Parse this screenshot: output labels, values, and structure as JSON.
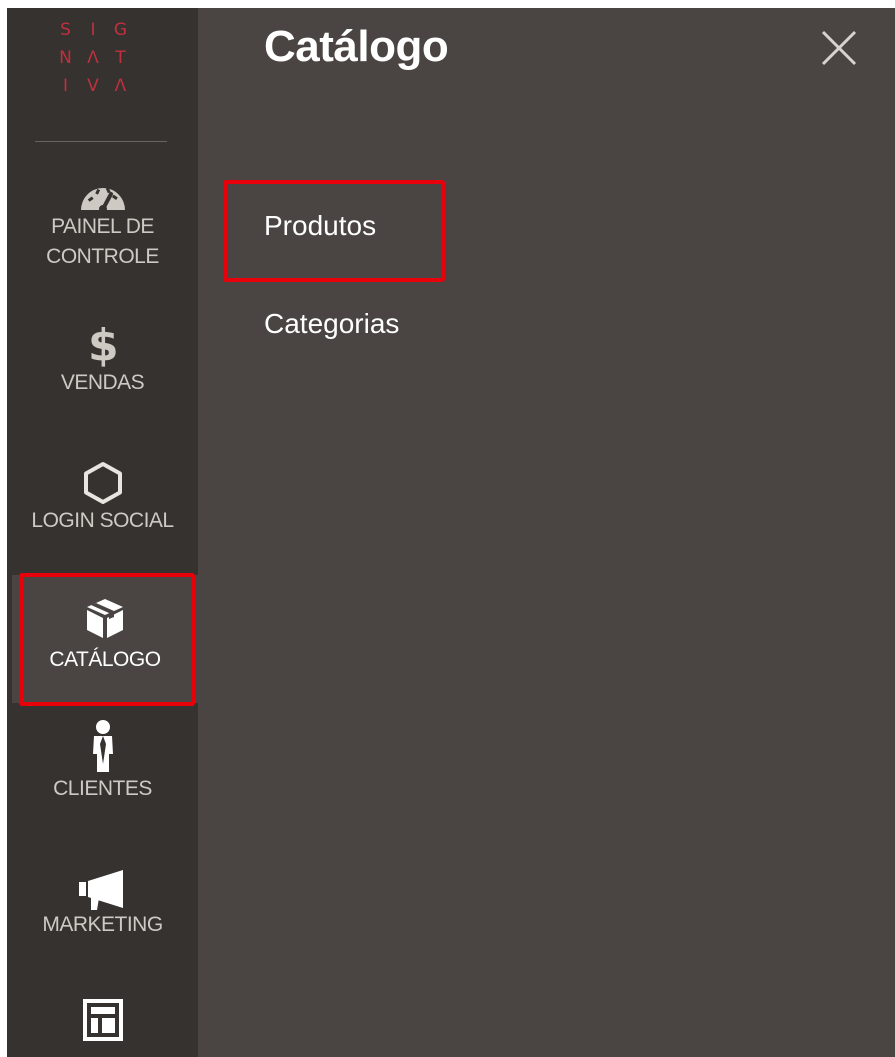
{
  "sidebar": {
    "logo_letters": [
      [
        "S",
        "I",
        "G"
      ],
      [
        "N",
        "Λ",
        "T"
      ],
      [
        "I",
        "V",
        "Λ"
      ]
    ],
    "items": [
      {
        "label_lines": [
          "PAINEL DE",
          "CONTROLE"
        ],
        "icon": "dashboard-gauge-icon"
      },
      {
        "label_lines": [
          "VENDAS"
        ],
        "icon": "dollar-icon"
      },
      {
        "label_lines": [
          "LOGIN SOCIAL"
        ],
        "icon": "hexagon-icon"
      },
      {
        "label_lines": [
          "CATÁLOGO"
        ],
        "icon": "box-icon",
        "active": true
      },
      {
        "label_lines": [
          "CLIENTES"
        ],
        "icon": "person-icon"
      },
      {
        "label_lines": [
          "MARKETING"
        ],
        "icon": "megaphone-icon"
      },
      {
        "label_lines": [
          ""
        ],
        "icon": "layout-icon"
      }
    ]
  },
  "panel": {
    "title": "Catálogo",
    "links": [
      "Produtos",
      "Categorias"
    ]
  },
  "colors": {
    "sidebar_bg": "#363230",
    "panel_bg": "#4a4542",
    "logo": "#c0303e",
    "highlight": "#e8000b"
  }
}
